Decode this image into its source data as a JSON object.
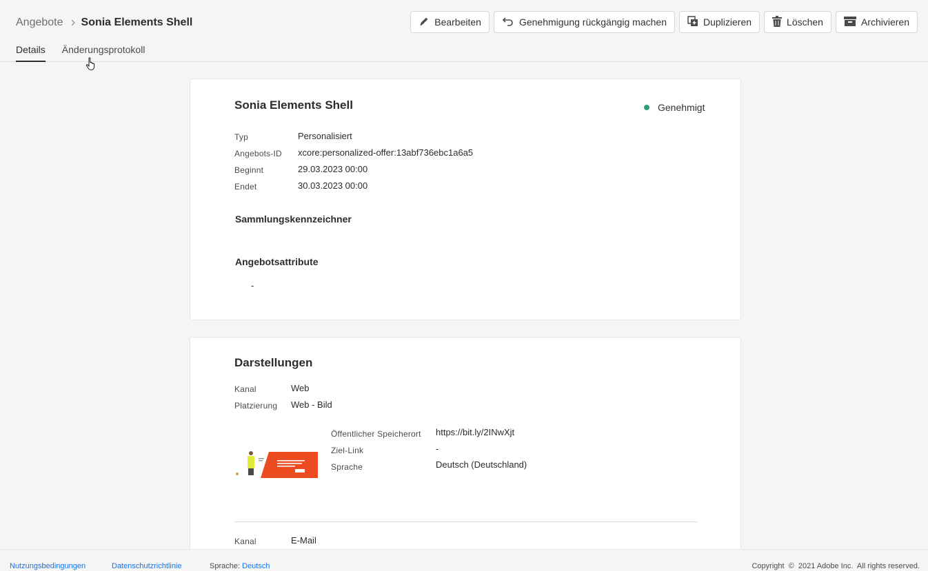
{
  "breadcrumb": {
    "parent": "Angebote",
    "current": "Sonia Elements Shell"
  },
  "toolbar": {
    "edit_label": "Bearbeiten",
    "undo_approval_label": "Genehmigung rückgängig machen",
    "duplicate_label": "Duplizieren",
    "delete_label": "Löschen",
    "archive_label": "Archivieren"
  },
  "tabs": [
    {
      "label": "Details",
      "active": true
    },
    {
      "label": "Änderungsprotokoll",
      "active": false
    }
  ],
  "offer": {
    "title": "Sonia Elements Shell",
    "status": "Genehmigt",
    "status_color": "#2d9d78",
    "fields": [
      {
        "label": "Typ",
        "value": "Personalisiert"
      },
      {
        "label": "Angebots-ID",
        "value": "xcore:personalized-offer:13abf736ebc1a6a5"
      },
      {
        "label": "Beginnt",
        "value": "29.03.2023 00:00"
      },
      {
        "label": "Endet",
        "value": "30.03.2023 00:00"
      }
    ],
    "collection_heading": "Sammlungskennzeichner",
    "attributes_heading": "Angebotsattribute",
    "attributes_value": "-"
  },
  "representations": {
    "title": "Darstellungen",
    "web": {
      "channel_label": "Kanal",
      "channel_value": "Web",
      "placement_label": "Platzierung",
      "placement_value": "Web - Bild",
      "public_location_label": "Öffentlicher Speicherort",
      "public_location_value": "https://bit.ly/2INwXjt",
      "target_link_label": "Ziel-Link",
      "target_link_value": "-",
      "language_label": "Sprache",
      "language_value": "Deutsch (Deutschland)"
    },
    "email": {
      "channel_label": "Kanal",
      "channel_value": "E-Mail"
    }
  },
  "footer": {
    "terms": "Nutzungsbedingungen",
    "privacy": "Datenschutzrichtlinie",
    "language_label": "Sprache:",
    "language_value": "Deutsch",
    "copyright": "Copyright  ©  2021 Adobe Inc.  All rights reserved."
  }
}
